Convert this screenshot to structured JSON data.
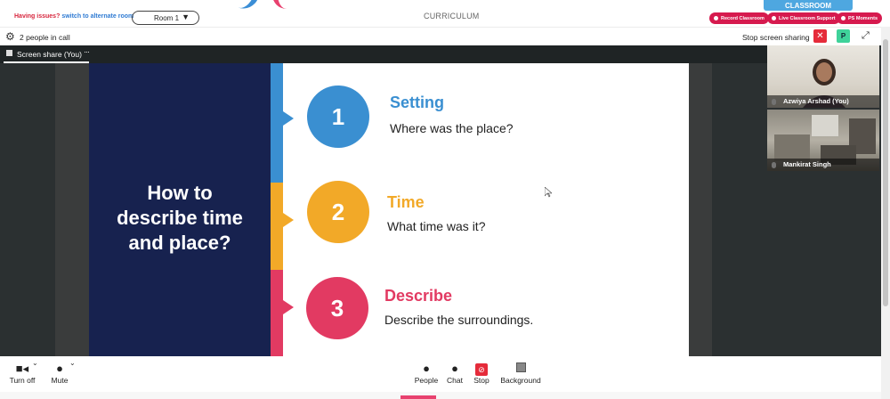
{
  "topbar": {
    "issues_text": "Having issues?",
    "alternate_link": "switch to alternate room",
    "room_label": "Room 1",
    "room_caret": "▼",
    "page_heading": "CURRICULUM",
    "classroom_tab": "CLASSROOM",
    "pills": [
      "Record Classroom",
      "Live Classroom Support",
      "PS Moments"
    ]
  },
  "callbar": {
    "people_count": "2 people in call",
    "stop_sharing": "Stop screen sharing",
    "close_glyph": "✕",
    "p_badge": "P",
    "expand_glyph": "⤢"
  },
  "share": {
    "label": "Screen share (You)",
    "more": "···"
  },
  "slide": {
    "question_lines": [
      "How to",
      "describe time",
      "and place?"
    ],
    "steps": [
      {
        "num": "1",
        "title": "Setting",
        "desc": "Where was the place?",
        "color": "#3a8fd1"
      },
      {
        "num": "2",
        "title": "Time",
        "desc": "What time was it?",
        "color": "#f2a928"
      },
      {
        "num": "3",
        "title": "Describe",
        "desc": "Describe the surroundings.",
        "color": "#e23a62"
      }
    ],
    "navy": "#17224f"
  },
  "participants": [
    {
      "name": "Azwiya Arshad (You)"
    },
    {
      "name": "Mankirat Singh"
    }
  ],
  "controls": {
    "camera": "Turn off",
    "mic": "Mute",
    "people": "People",
    "chat": "Chat",
    "stop": "Stop",
    "background": "Background"
  },
  "colors": {
    "accent_red": "#d61a4e",
    "classroom_blue": "#4ea7e0",
    "green_badge": "#3fd29a"
  }
}
